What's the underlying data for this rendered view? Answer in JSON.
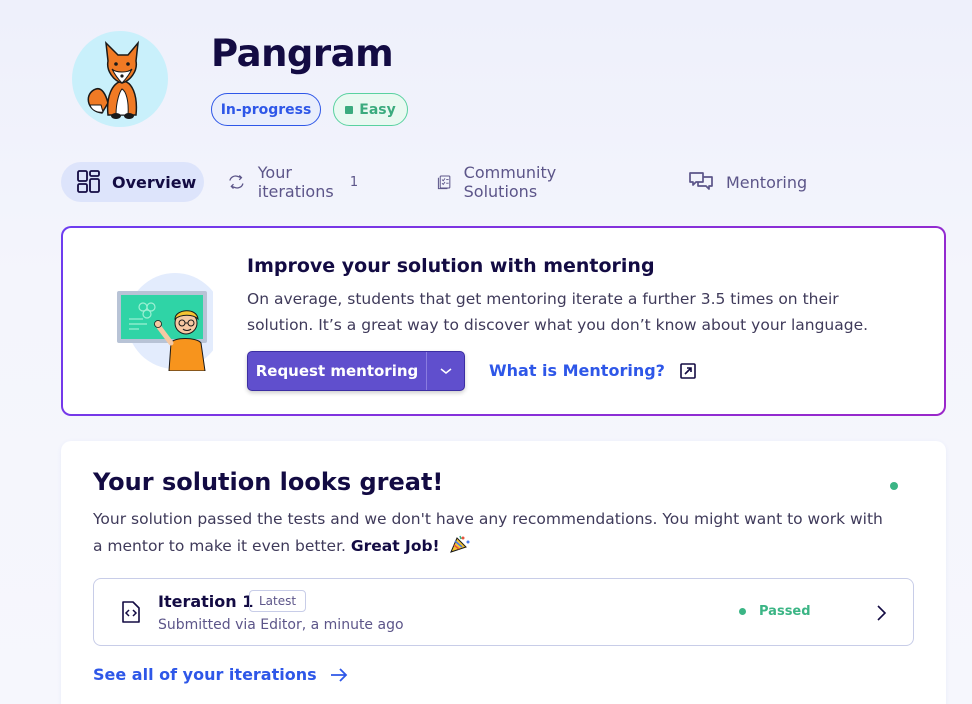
{
  "exercise": {
    "title": "Pangram",
    "status_tag": "In-progress",
    "difficulty_tag": "Easy"
  },
  "tabs": [
    {
      "label": "Overview",
      "icon": "overview-icon",
      "active": true
    },
    {
      "label": "Your iterations",
      "icon": "iterations-icon",
      "count": "1"
    },
    {
      "label": "Community Solutions",
      "icon": "community-solutions-icon"
    },
    {
      "label": "Mentoring",
      "icon": "mentoring-icon"
    }
  ],
  "mentoring": {
    "title": "Improve your solution with mentoring",
    "text": "On average, students that get mentoring iterate a further 3.5 times on their solution. It’s a great way to discover what you don’t know about your language.",
    "request_button": "Request mentoring",
    "what_link": "What is Mentoring?"
  },
  "solution": {
    "title": "Your solution looks great!",
    "text_main": "Your solution passed the tests and we don't have any recommendations. You might want to work with a mentor to make it even better. ",
    "text_bold": "Great Job!",
    "iteration": {
      "name": "Iteration 1",
      "badge": "Latest",
      "submitted": "Submitted via Editor, a minute ago",
      "status": "Passed"
    },
    "see_all_link": "See all of your iterations"
  },
  "colors": {
    "accent": "#604fcd",
    "link": "#2e57e8",
    "success": "#3bb585",
    "heading": "#130b43"
  }
}
